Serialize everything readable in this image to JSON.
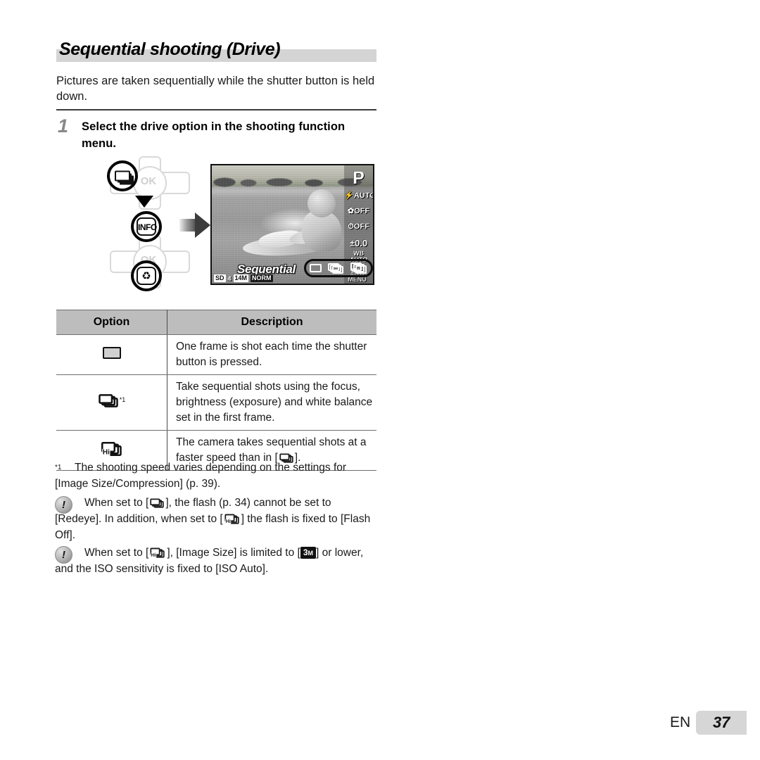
{
  "heading": {
    "title": "Sequential shooting (Drive)"
  },
  "intro": "Pictures are taken sequentially while the shutter button is held down.",
  "step": {
    "number": "1",
    "text": "Select the drive option in the shooting function menu."
  },
  "diagram": {
    "ok_label": "OK",
    "info_label": "INFO",
    "trash_icon": "trash-icon",
    "sequential_button_icon": "sequential-button-icon",
    "down_arrow_icon": "down-arrow-icon",
    "right_arrow_icon": "right-arrow-icon"
  },
  "lcd": {
    "mode": "P",
    "flash": "AUTO",
    "macro": "OFF",
    "selftimer": "OFF",
    "exposure": "±0.0",
    "wb_label": "WB",
    "wb_value": "AUTO",
    "iso_label": "ISO",
    "iso_value": "AUTO",
    "menu": "MENU",
    "drive_label": "Sequential",
    "status": {
      "card": "SD",
      "count": "4",
      "size": "14M",
      "quality": "NORM"
    },
    "drive_options": [
      "single-frame-icon",
      "sequential-icon",
      "hi-sequential-icon"
    ]
  },
  "table": {
    "headers": [
      "Option",
      "Description"
    ],
    "rows": [
      {
        "icon": "single-frame-icon",
        "footnote_mark": "",
        "description": "One frame is shot each time the shutter button is pressed."
      },
      {
        "icon": "sequential-icon",
        "footnote_mark": "*1",
        "description": "Take sequential shots using the focus, brightness (exposure) and white balance set in the first frame."
      },
      {
        "icon": "hi-sequential-icon",
        "footnote_mark": "",
        "description_part1": "The camera takes sequential shots at a faster speed than in [",
        "description_part2": "]."
      }
    ]
  },
  "footnote": {
    "mark": "*1",
    "text": "The shooting speed varies depending on the settings for [Image Size/Compression] (p. 39)."
  },
  "notes": [
    {
      "bullet": "!",
      "part1": "When set to [",
      "part2": "], the flash (p. 34) cannot be set to [Redeye]. In addition, when set to [",
      "part3": "] the flash is fixed to [Flash Off]."
    },
    {
      "bullet": "!",
      "part1": "When set to [",
      "part2": "], [Image Size] is limited to [",
      "badge": "3",
      "badge_sub": "M",
      "part3": "] or lower, and the ISO sensitivity is fixed to [ISO Auto]."
    }
  ],
  "footer": {
    "language": "EN",
    "page": "37"
  }
}
